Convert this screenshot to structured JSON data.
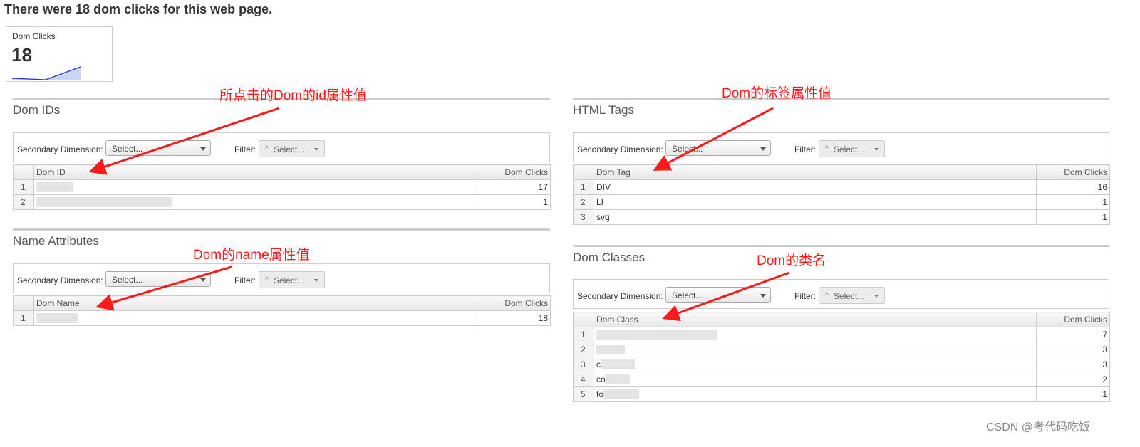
{
  "headline": "There were 18 dom clicks for this web page.",
  "summary_card": {
    "label": "Dom Clicks",
    "value": "18"
  },
  "common": {
    "secondary_dimension_label": "Secondary Dimension:",
    "secondary_dimension_placeholder": "Select...",
    "filter_label": "Filter:",
    "filter_placeholder": "Select..."
  },
  "sections": {
    "dom_ids": {
      "title": "Dom IDs",
      "col_dim": "Dom ID",
      "col_metric": "Dom Clicks",
      "rows": [
        {
          "idx": "1",
          "value": "17"
        },
        {
          "idx": "2",
          "value": "1"
        }
      ]
    },
    "name_attributes": {
      "title": "Name Attributes",
      "col_dim": "Dom Name",
      "col_metric": "Dom Clicks",
      "rows": [
        {
          "idx": "1",
          "value": "18"
        }
      ]
    },
    "html_tags": {
      "title": "HTML Tags",
      "col_dim": "Dom Tag",
      "col_metric": "Dom Clicks",
      "rows": [
        {
          "idx": "1",
          "name": "DIV",
          "value": "16"
        },
        {
          "idx": "2",
          "name": "LI",
          "value": "1"
        },
        {
          "idx": "3",
          "name": "svg",
          "value": "1"
        }
      ]
    },
    "dom_classes": {
      "title": "Dom Classes",
      "col_dim": "Dom Class",
      "col_metric": "Dom Clicks",
      "rows": [
        {
          "idx": "1",
          "name": "",
          "value": "7"
        },
        {
          "idx": "2",
          "name": "",
          "value": "3"
        },
        {
          "idx": "3",
          "name": "c",
          "value": "3"
        },
        {
          "idx": "4",
          "name": "co",
          "value": "2"
        },
        {
          "idx": "5",
          "name": "fo",
          "value": "1"
        }
      ]
    }
  },
  "annotations": {
    "dom_id": "所点击的Dom的id属性值",
    "dom_tag": "Dom的标签属性值",
    "dom_name": "Dom的name属性值",
    "dom_class": "Dom的类名"
  },
  "annotation_color": "#ff1a1a",
  "watermark": "CSDN @考代码吃饭"
}
